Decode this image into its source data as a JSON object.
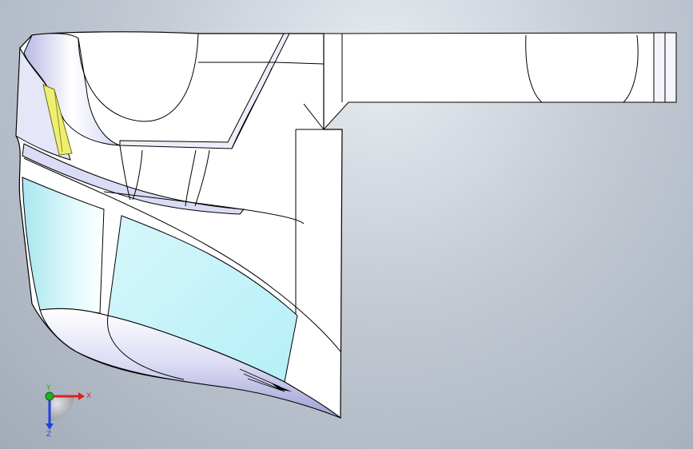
{
  "view": {
    "background_top": "#e7ebf1",
    "background_bottom": "#a2acb9"
  },
  "model": {
    "face_color": "#ffffff",
    "edge_color": "#000000",
    "glass_color": "#bdf0f8",
    "highlight_color": "#f3f27a",
    "shade_color": "#c9c9f2"
  },
  "triad": {
    "x_label": "X",
    "y_label": "Y",
    "z_label": "Z",
    "x_color": "#e02020",
    "y_color": "#20b020",
    "z_color": "#2040e0"
  }
}
